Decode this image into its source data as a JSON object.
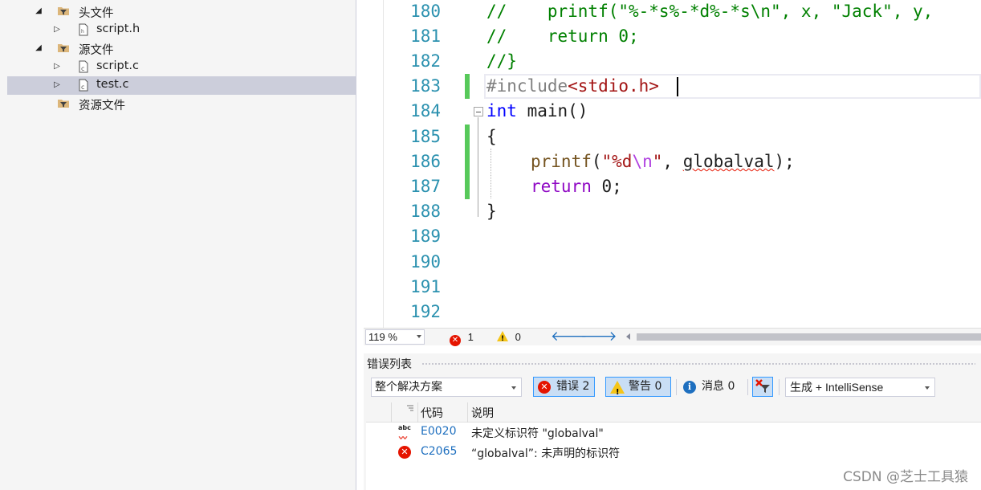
{
  "explorer": {
    "items": [
      {
        "label": "头文件",
        "type": "folder",
        "expanded": true
      },
      {
        "label": "script.h",
        "type": "h-file"
      },
      {
        "label": "源文件",
        "type": "folder",
        "expanded": true
      },
      {
        "label": "script.c",
        "type": "c-file"
      },
      {
        "label": "test.c",
        "type": "c-file",
        "selected": true
      },
      {
        "label": "资源文件",
        "type": "folder"
      }
    ]
  },
  "editor": {
    "line_numbers": [
      "180",
      "181",
      "182",
      "183",
      "184",
      "185",
      "186",
      "187",
      "188",
      "189",
      "190",
      "191",
      "192"
    ],
    "code": {
      "l180": "//    printf(\"%-*s%-*d%-*s\\n\", x, \"Jack\", y,",
      "l181": "//    return 0;",
      "l182": "//}",
      "l183_pp": "#include",
      "l183_hdr": "<stdio.h>",
      "l184_kw": "int",
      "l184_rest": " main()",
      "l185": "{",
      "l186_fn": "printf",
      "l186_open": "(",
      "l186_str1": "\"%d",
      "l186_esc": "\\n",
      "l186_str2": "\"",
      "l186_mid": ", ",
      "l186_err": "globalval",
      "l186_end": ");",
      "l187_kw": "return",
      "l187_rest": " 0;",
      "l188": "}"
    }
  },
  "status_bar": {
    "zoom": "119 %",
    "error_count": "1",
    "warning_count": "0",
    "back_arrow": "🡐",
    "forward_arrow": "🡒"
  },
  "error_list": {
    "title": "错误列表",
    "scope": "整个解决方案",
    "errors_btn": "错误 2",
    "warnings_btn": "警告 0",
    "messages_btn": "消息 0",
    "build_filter": "生成 + IntelliSense",
    "columns": {
      "code": "代码",
      "description": "说明"
    },
    "rows": [
      {
        "icon": "intellisense-error",
        "code": "E0020",
        "description": "未定义标识符 \"globalval\""
      },
      {
        "icon": "error",
        "code": "C2065",
        "description": "“globalval”: 未声明的标识符"
      }
    ]
  },
  "watermark": "CSDN @芝士工具猿",
  "colors": {
    "line_number": "#2b91af",
    "keyword": "#0000ff",
    "comment": "#008000",
    "string": "#a31515",
    "change_bar": "#57c95a",
    "error": "#e51400",
    "selection": "#cccedb"
  }
}
